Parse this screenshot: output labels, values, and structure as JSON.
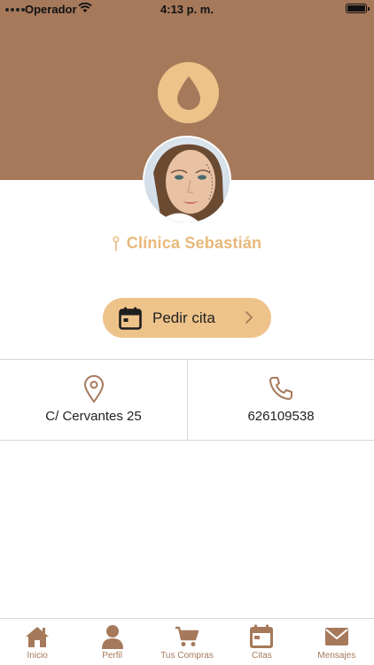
{
  "status_bar": {
    "carrier": "Operador",
    "time": "4:13 p. m."
  },
  "header": {
    "logo_icon": "drop-icon",
    "avatar": "clinic-profile-photo"
  },
  "clinic": {
    "name": "Clínica Sebastián"
  },
  "appointment_button": {
    "label": "Pedir cita"
  },
  "info": {
    "address": "C/ Cervantes 25",
    "phone": "626109538"
  },
  "tabbar": {
    "items": [
      {
        "label": "Inicio",
        "icon": "home-icon"
      },
      {
        "label": "Perfil",
        "icon": "user-icon"
      },
      {
        "label": "Tus Compras",
        "icon": "cart-icon"
      },
      {
        "label": "Citas",
        "icon": "calendar-icon"
      },
      {
        "label": "Mensajes",
        "icon": "mail-icon"
      }
    ]
  },
  "colors": {
    "brand_brown": "#a6795b",
    "brand_gold": "#eec38a",
    "clinic_name": "#e8b87a"
  }
}
